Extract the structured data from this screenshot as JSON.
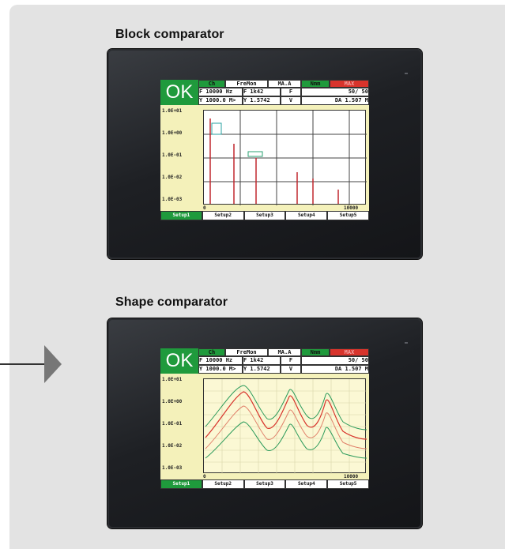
{
  "panels": [
    {
      "heading": "Block comparator",
      "header": {
        "ok": "OK",
        "cells": [
          "Ch",
          "FreMon",
          "MA.A",
          "Nmm",
          "MAX"
        ],
        "row2": [
          "F  10000 Hz",
          "F  1k42",
          "F",
          "50/   50"
        ],
        "row3": [
          "Y 1000.0  M>",
          "Y 1.5742",
          "V",
          "DA 1.507  M"
        ]
      },
      "y_labels": [
        "1.0E+01",
        "1.0E+00",
        "1.0E-01",
        "1.0E-02",
        "1.0E-03"
      ],
      "x_labels": [
        "0",
        "10000"
      ],
      "tabs": [
        "Setup1",
        "Setup2",
        "Setup3",
        "Setup4",
        "Setup5"
      ],
      "active_tab": 0
    },
    {
      "heading": "Shape comparator",
      "header": {
        "ok": "OK",
        "cells": [
          "Ch",
          "FreMon",
          "MA.A",
          "Nmm",
          "MAX"
        ],
        "row2": [
          "F  10000 Hz",
          "F  1k42",
          "F",
          "50/   50"
        ],
        "row3": [
          "Y 1000.0  M>",
          "Y 1.5742",
          "V",
          "DA 1.507  M"
        ]
      },
      "y_labels": [
        "1.0E+01",
        "1.0E+00",
        "1.0E-01",
        "1.0E-02",
        "1.0E-03"
      ],
      "x_labels": [
        "0",
        "10000"
      ],
      "tabs": [
        "Setup1",
        "Setup2",
        "Setup3",
        "Setup4",
        "Setup5"
      ],
      "active_tab": 0
    }
  ],
  "colors": {
    "ok_green": "#1f9a3c",
    "alarm_red": "#d8342c",
    "screen_bg": "#f4f1ba",
    "arrow": "#777777"
  }
}
